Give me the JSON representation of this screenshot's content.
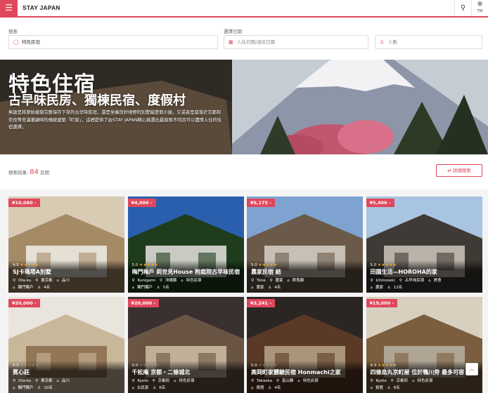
{
  "header": {
    "logo": "STAY JAPAN",
    "menu_icon": "hamburger-icon",
    "search_icon": "search-icon",
    "lang_icon": "globe-icon",
    "lang_code": "TW"
  },
  "search": {
    "keyword_label": "搜索",
    "keyword_value": "特色民宿",
    "date_label": "選擇日期",
    "date_placeholder": "入住日期/退房日期",
    "guests_placeholder": "人數"
  },
  "hero": {
    "title": "特色住宿",
    "subtitle": "古早味民房、獨棟民宿、度假村",
    "description": "無論是將原始樣貌完整保存下來的古早味民宿，還是坐擁良好視野的別墅級度假小屋，又或者是座落於京都和奈良等充滿著韻味的傳統建築「町家」，這裡提供了由STAY JAPAN精心挑選出最與眾不同且可以盡情入住的住宿選擇。"
  },
  "results": {
    "label": "搜索結果:",
    "count": "84",
    "unit": "房間",
    "filter_button": "詳細搜索"
  },
  "colors": {
    "accent": "#e0475c",
    "star": "#f5a623"
  },
  "cards": [
    {
      "price": "¥10,080 -",
      "rating": "4.5",
      "stars": "★★★★★",
      "stars_empty": "",
      "name": "SJ卡瑪塔A別墅",
      "loc": [
        "Ota-ku",
        "東京都",
        "品川"
      ],
      "tags": [
        "獨門獨戶",
        "4名"
      ]
    },
    {
      "price": "¥4,000 -",
      "rating": "5.0",
      "stars": "★★★★★",
      "stars_empty": "",
      "name": "梅門梅戶 莉世見House 附庭院古早味民宿",
      "loc": [
        "Kunigami",
        "沖縄縣",
        "特色民宿"
      ],
      "tags": [
        "獨門獨戶",
        "5名"
      ]
    },
    {
      "price": "¥5,175 -",
      "rating": "5.0",
      "stars": "★★★★★",
      "stars_empty": "",
      "name": "農家民宿 結",
      "loc": [
        "Tone",
        "農家",
        "群馬縣"
      ],
      "tags": [
        "農家",
        "4名"
      ]
    },
    {
      "price": "¥5,400 -",
      "rating": "5.0",
      "stars": "★★★★★",
      "stars_empty": "",
      "name": "田園生活—HOROHA的家",
      "loc": [
        "Ichinoseki",
        "古早味民宿",
        "美食"
      ],
      "tags": [
        "農家",
        "12名"
      ]
    },
    {
      "price": "¥20,000 -",
      "rating": "0.0",
      "stars": "",
      "stars_empty": "☆☆☆☆☆",
      "name": "賓心莊",
      "loc": [
        "Ota-ku",
        "東京都",
        "品川"
      ],
      "tags": [
        "獨門獨戶",
        "10名"
      ]
    },
    {
      "price": "¥20,000 -",
      "rating": "0.0",
      "stars": "",
      "stars_empty": "☆☆☆☆☆",
      "name": "千松庵 京都・二條城北",
      "loc": [
        "Kyoto",
        "京都府",
        "特色民宿"
      ],
      "tags": [
        "古民家",
        "6名"
      ]
    },
    {
      "price": "¥3,241 -",
      "rating": "0.0",
      "stars": "",
      "stars_empty": "☆☆☆☆☆",
      "name": "高岡町家體驗民宿 Honmachi之家",
      "loc": [
        "Takaoka",
        "富山縣",
        "特色民宿"
      ],
      "tags": [
        "賓館",
        "4名"
      ]
    },
    {
      "price": "¥19,000 -",
      "rating": "4.3",
      "stars": "★★★★",
      "stars_empty": "★",
      "name": "四條烏丸京町屋 位於鴨川旁 最多可容",
      "loc": [
        "Kyoto",
        "京都府",
        "特色民宿"
      ],
      "tags": [
        "賓館",
        "8名"
      ]
    }
  ]
}
